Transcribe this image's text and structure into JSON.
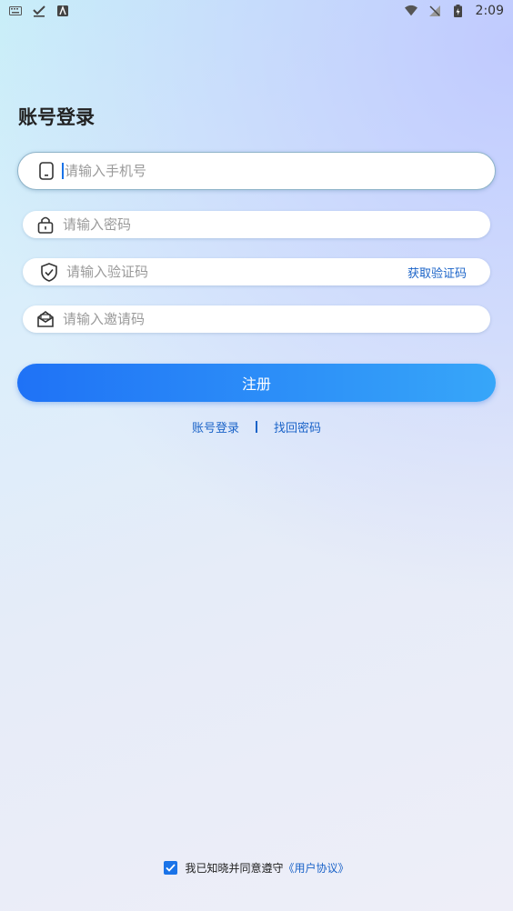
{
  "status_bar": {
    "time": "2:09"
  },
  "page": {
    "title": "账号登录"
  },
  "form": {
    "phone_placeholder": "请输入手机号",
    "password_placeholder": "请输入密码",
    "code_placeholder": "请输入验证码",
    "get_code_label": "获取验证码",
    "invite_placeholder": "请输入邀请码",
    "register_label": "注册"
  },
  "links": {
    "login_label": "账号登录",
    "forgot_label": "找回密码"
  },
  "agreement": {
    "text": "我已知晓并同意遵守",
    "link_text": "《用户协议》",
    "checked": true
  },
  "colors": {
    "accent": "#1a73e8",
    "link": "#1a63c8",
    "button_start": "#1f72f6",
    "button_end": "#37a6f9"
  }
}
